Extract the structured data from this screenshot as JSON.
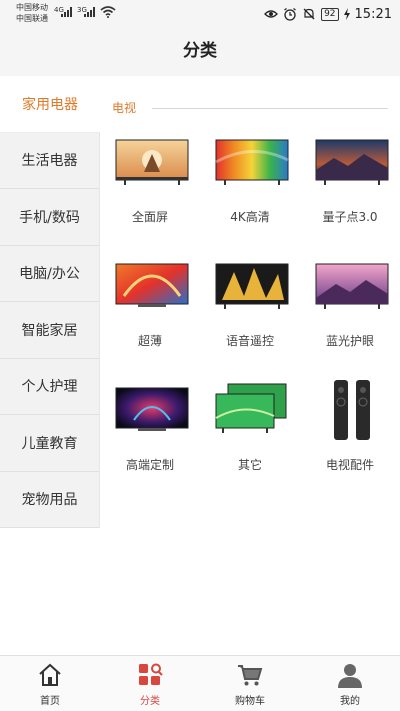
{
  "status_bar": {
    "carrier1": "中国移动",
    "carrier2": "中国联通",
    "net1": "4G",
    "net2": "3G",
    "battery": "92",
    "time": "15:21"
  },
  "header": {
    "title": "分类"
  },
  "sidebar": {
    "items": [
      {
        "label": "家用电器"
      },
      {
        "label": "生活电器"
      },
      {
        "label": "手机/数码"
      },
      {
        "label": "电脑/办公"
      },
      {
        "label": "智能家居"
      },
      {
        "label": "个人护理"
      },
      {
        "label": "儿童教育"
      },
      {
        "label": "宠物用品"
      }
    ],
    "active_index": 0
  },
  "main": {
    "section_title": "电视",
    "products": [
      {
        "label": "全面屏",
        "icon": "tv-fullscreen-thumbnail"
      },
      {
        "label": "4K高清",
        "icon": "tv-4k-thumbnail"
      },
      {
        "label": "量子点3.0",
        "icon": "tv-quantum-dot-thumbnail"
      },
      {
        "label": "超薄",
        "icon": "tv-ultra-thin-thumbnail"
      },
      {
        "label": "语音遥控",
        "icon": "tv-voice-remote-thumbnail"
      },
      {
        "label": "蓝光护眼",
        "icon": "tv-blue-light-thumbnail"
      },
      {
        "label": "高端定制",
        "icon": "tv-premium-thumbnail"
      },
      {
        "label": "其它",
        "icon": "tv-other-thumbnail"
      },
      {
        "label": "电视配件",
        "icon": "tv-remote-accessory-thumbnail"
      }
    ]
  },
  "bottom_nav": {
    "items": [
      {
        "label": "首页",
        "icon": "home-icon"
      },
      {
        "label": "分类",
        "icon": "category-icon"
      },
      {
        "label": "购物车",
        "icon": "cart-icon"
      },
      {
        "label": "我的",
        "icon": "profile-icon"
      }
    ],
    "active_index": 1
  },
  "colors": {
    "accent": "#e07a2a",
    "nav_active": "#d9463e"
  }
}
